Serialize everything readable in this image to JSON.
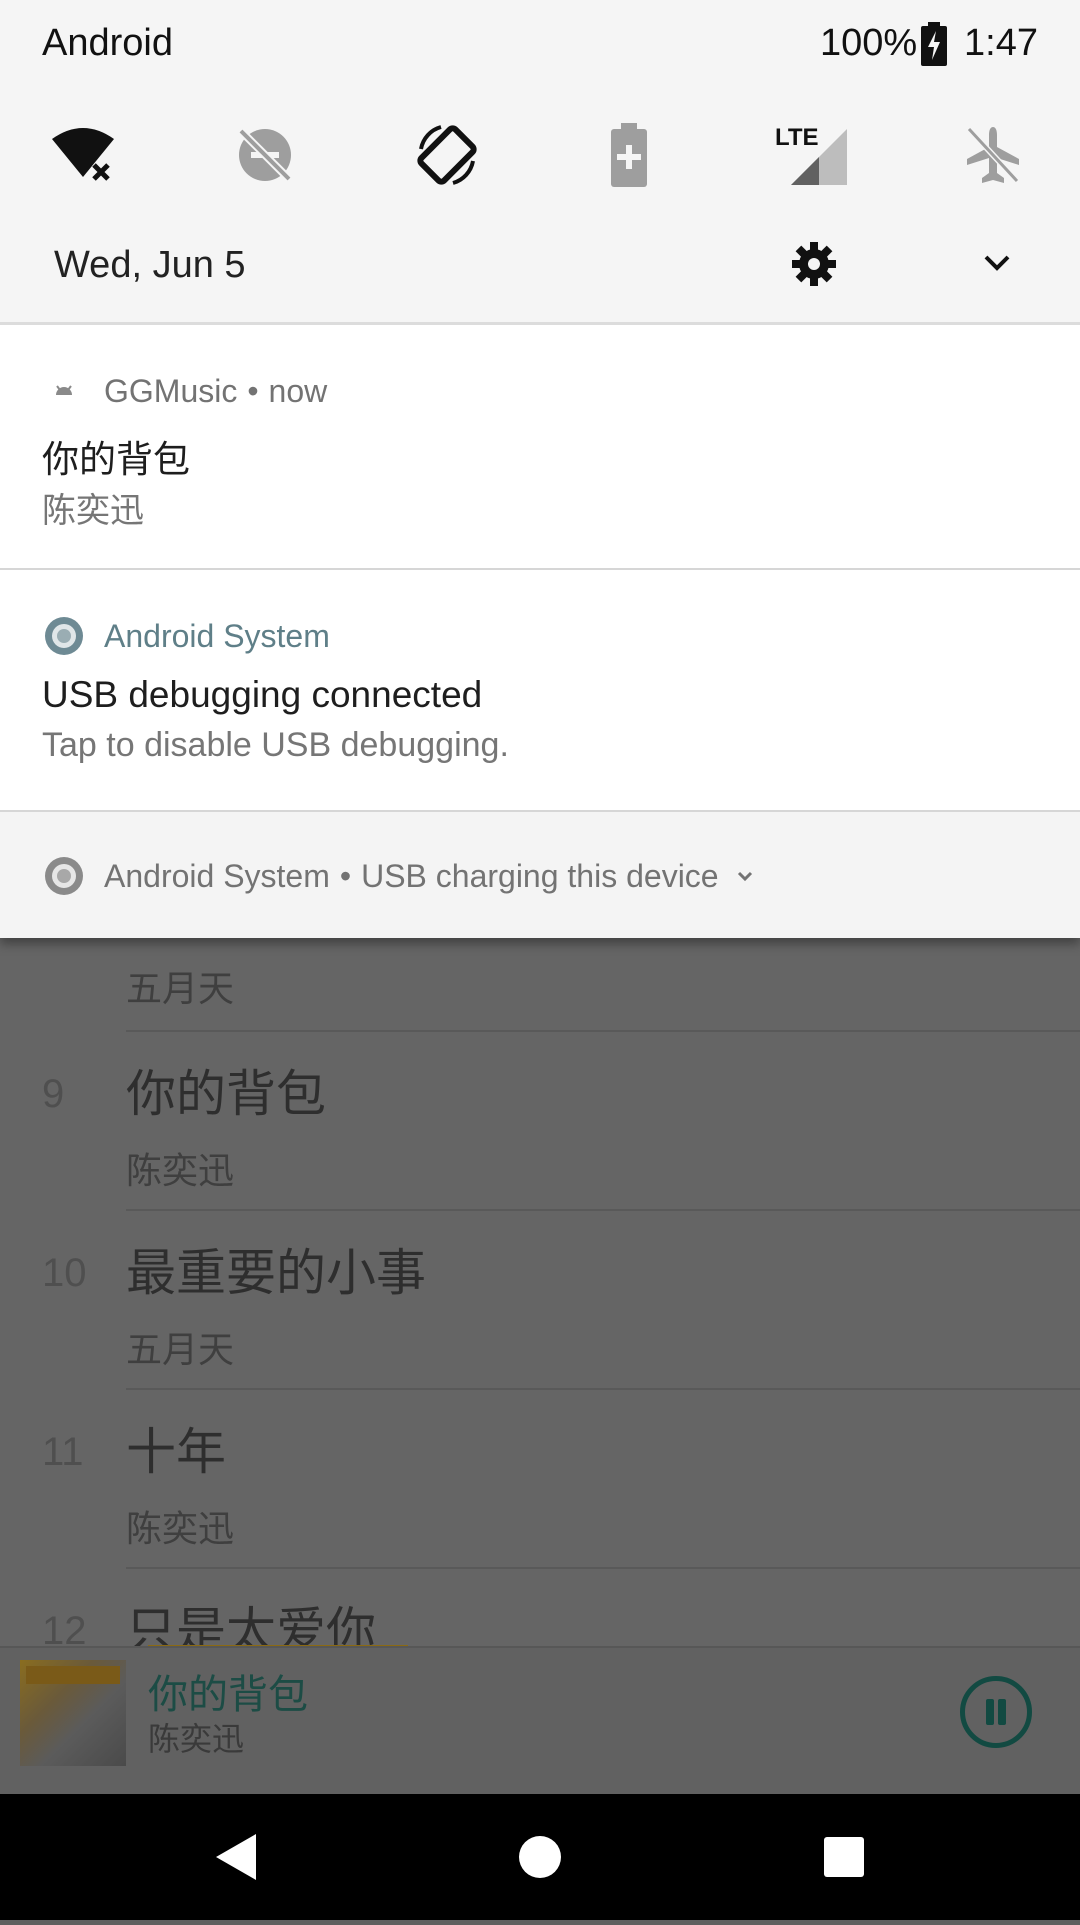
{
  "status_bar": {
    "carrier": "Android",
    "battery_percent": "100%",
    "time": "1:47",
    "battery_icon": "battery-charging-icon"
  },
  "quick_settings": [
    {
      "name": "wifi-off-icon"
    },
    {
      "name": "dnd-off-icon"
    },
    {
      "name": "auto-rotate-icon"
    },
    {
      "name": "battery-saver-icon"
    },
    {
      "name": "lte-signal-icon",
      "label": "LTE"
    },
    {
      "name": "airplane-mode-icon"
    }
  ],
  "date_row": {
    "date": "Wed, Jun 5",
    "settings_icon": "gear-icon",
    "expand_icon": "chevron-down-icon"
  },
  "notifications": {
    "music": {
      "app_name": "GGMusic",
      "separator": "•",
      "time": "now",
      "title": "你的背包",
      "text": "陈奕迅"
    },
    "usb_debugging": {
      "app_name": "Android System",
      "title": "USB debugging connected",
      "text": "Tap to disable USB debugging."
    },
    "usb_charging": {
      "app_name": "Android System",
      "separator": "•",
      "summary": "USB charging this device"
    }
  },
  "song_list": [
    {
      "number": "",
      "title": "",
      "artist": "五月天"
    },
    {
      "number": "9",
      "title": "你的背包",
      "artist": "陈奕迅"
    },
    {
      "number": "10",
      "title": "最重要的小事",
      "artist": "五月天"
    },
    {
      "number": "11",
      "title": "十年",
      "artist": "陈奕迅"
    },
    {
      "number": "12",
      "title": "只是太爱你",
      "artist": ""
    }
  ],
  "mini_player": {
    "title": "你的背包",
    "artist": "陈奕迅",
    "pause_icon": "pause-icon"
  },
  "nav_bar": {
    "back_icon": "back-triangle-icon",
    "home_icon": "home-circle-icon",
    "recents_icon": "recents-square-icon"
  },
  "colors": {
    "shade_bg": "#f5f5f5",
    "scrim": "#656565",
    "accent_teal": "#124a42",
    "android_system_teal": "#5f7f88"
  }
}
